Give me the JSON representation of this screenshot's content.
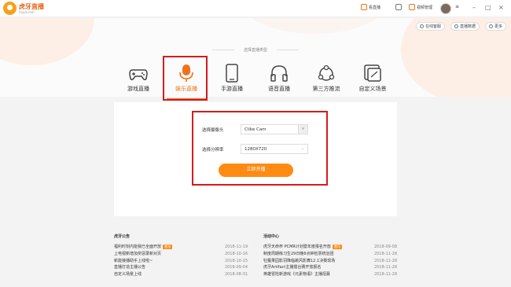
{
  "app": {
    "logo_name": "虎牙直播",
    "logo_domain": "huya.com"
  },
  "titlebar": {
    "live_label": "看直播",
    "video_manage_label": "视频管理",
    "min": "–",
    "max": "□",
    "close": "×"
  },
  "toolbar": {
    "online_service": "在线客服",
    "live_data": "直播数据",
    "more": "更多"
  },
  "section_title": "选择直播类型",
  "tabs": [
    {
      "label": "游戏直播",
      "icon": "gamepad-icon"
    },
    {
      "label": "娱乐直播",
      "icon": "microphone-icon",
      "active": true
    },
    {
      "label": "手游直播",
      "icon": "phone-icon"
    },
    {
      "label": "语音直播",
      "icon": "headphones-icon"
    },
    {
      "label": "第三方推流",
      "icon": "share-icon"
    },
    {
      "label": "自定义场景",
      "icon": "scene-icon"
    }
  ],
  "form": {
    "camera_label": "选择摄像头",
    "camera_value": "Clike Cam",
    "resolution_label": "选择分辨率",
    "resolution_value": "1280X720",
    "start_button": "立即开播"
  },
  "announcements": {
    "title": "虎牙公告",
    "items": [
      {
        "text": "福利时刻内能我已全面开放",
        "badge": "置顶",
        "date": "2018-11-19"
      },
      {
        "text": "上电视新增加奖惩录新对页",
        "date": "2018-10-16"
      },
      {
        "text": "新能接播助手上线啦~",
        "date": "2018-10-15"
      },
      {
        "text": "直播打造主播公告",
        "date": "2018-09-04"
      },
      {
        "text": "自定义场景上线",
        "date": "2018-08-31"
      }
    ]
  },
  "activities": {
    "title": "活动中心",
    "items": [
      {
        "text": "虎牙天命杯 PCMR计划暨年度报名开放",
        "badge": "置顶",
        "date": "2018-09-08"
      },
      {
        "text": "制度周期练习生29日晚6点钟检票统治团",
        "date": "2018-11-28"
      },
      {
        "text": "牡雁果园影羽降临跳风影舞12.1决赛现场",
        "date": "2018-11-28"
      },
      {
        "text": "虎牙Artifact主播擂台赛开放报名",
        "date": "2018-11-28"
      },
      {
        "text": "英雄冒险新游戏《元素物语》主播招募",
        "date": "2018-11-28"
      }
    ]
  },
  "colors": {
    "accent": "#ff8a14",
    "highlight_frame": "#d61b1b"
  }
}
